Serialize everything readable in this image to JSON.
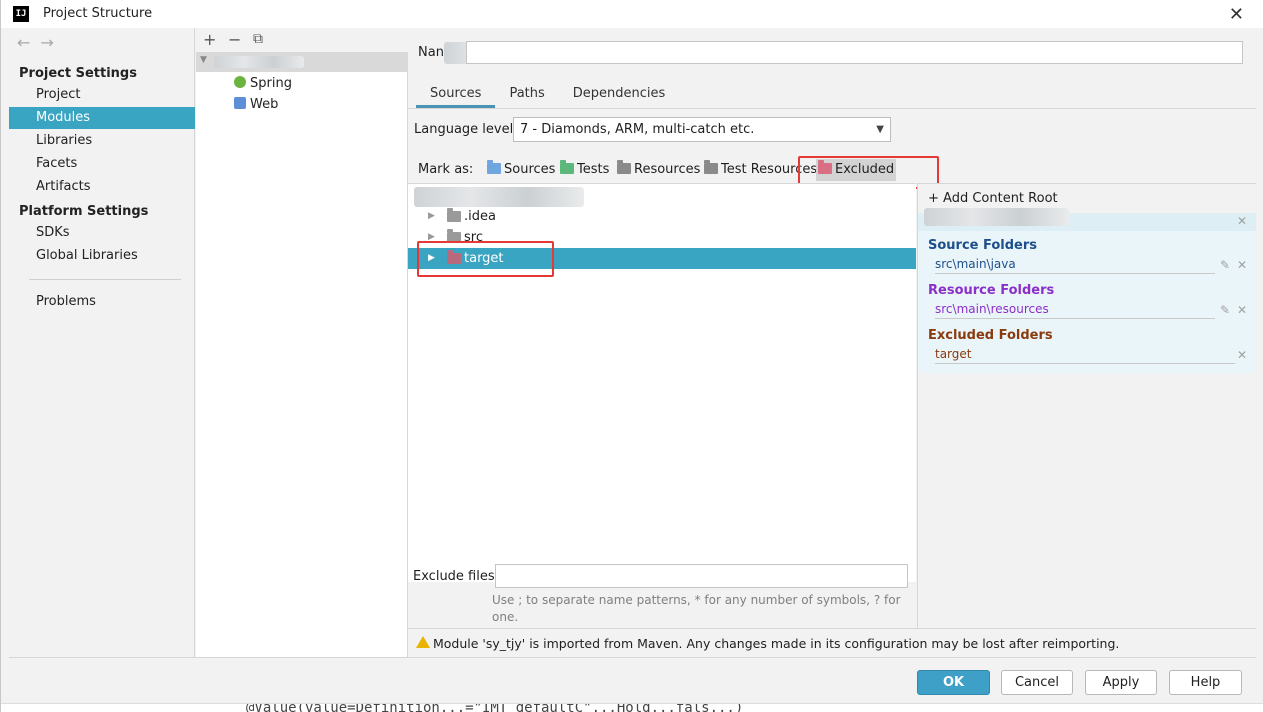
{
  "window": {
    "title": "Project Structure",
    "app_icon": "IJ"
  },
  "leftnav": {
    "sections": [
      {
        "title": "Project Settings",
        "items": [
          "Project",
          "Modules",
          "Libraries",
          "Facets",
          "Artifacts"
        ]
      },
      {
        "title": "Platform Settings",
        "items": [
          "SDKs",
          "Global Libraries"
        ]
      }
    ],
    "problems": "Problems",
    "selected": "Modules"
  },
  "modules": {
    "children": [
      {
        "label": "Spring",
        "icon": "spring-icon",
        "color": "#6db33f"
      },
      {
        "label": "Web",
        "icon": "web-icon",
        "color": "#5b8fd8"
      }
    ]
  },
  "main": {
    "name_label": "Nan",
    "tabs": [
      "Sources",
      "Paths",
      "Dependencies"
    ],
    "active_tab": "Sources",
    "language_level_label": "Language level:",
    "language_level_value": "7 - Diamonds, ARM, multi-catch etc.",
    "mark_as_label": "Mark as:",
    "mark_as": [
      {
        "label": "Sources",
        "color": "#6fa6e0"
      },
      {
        "label": "Tests",
        "color": "#5cb87a"
      },
      {
        "label": "Resources",
        "color": "#8a8a8a"
      },
      {
        "label": "Test Resources",
        "color": "#8a8a8a"
      },
      {
        "label": "Excluded",
        "color": "#d86f85"
      }
    ],
    "tree": [
      {
        "label": ".idea"
      },
      {
        "label": "src"
      },
      {
        "label": "target",
        "selected": true
      }
    ],
    "add_content_root": "Add Content Root",
    "source_folders_title": "Source Folders",
    "source_folders_path": "src\\main\\java",
    "resource_folders_title": "Resource Folders",
    "resource_folders_path": "src\\main\\resources",
    "excluded_folders_title": "Excluded Folders",
    "excluded_folders_path": "target",
    "exclude_files_label": "Exclude files:",
    "exclude_hint": "Use ; to separate name patterns, * for any number of symbols, ? for one.",
    "warning": "Module 'sy_tjy' is imported from Maven. Any changes made in its configuration may be lost after reimporting."
  },
  "buttons": {
    "ok": "OK",
    "cancel": "Cancel",
    "apply": "Apply",
    "help": "Help"
  },
  "code_strip": "@Value(value=Definition...=\"IMT defaultC\"...Hold...fals...)",
  "colors": {
    "accent": "#3aa5c2",
    "source_title": "#1d4f8c",
    "resource_title": "#8b2fc9",
    "excluded_title": "#8a3b0e",
    "highlight_box": "#e53935"
  }
}
